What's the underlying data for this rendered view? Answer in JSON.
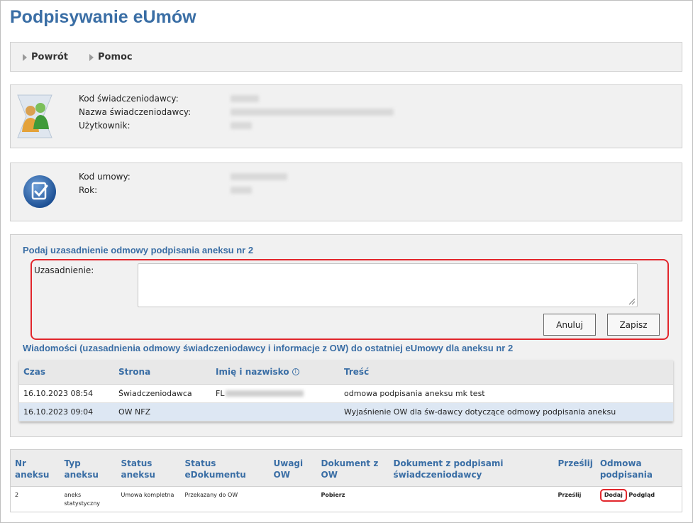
{
  "page": {
    "title": "Podpisywanie eUmów"
  },
  "nav": {
    "back_label": "Powrót",
    "help_label": "Pomoc"
  },
  "provider": {
    "code_label": "Kod świadczeniodawcy:",
    "name_label": "Nazwa świadczeniodawcy:",
    "user_label": "Użytkownik:"
  },
  "contract": {
    "code_label": "Kod umowy:",
    "year_label": "Rok:"
  },
  "reason_form": {
    "heading": "Podaj uzasadnienie odmowy podpisania aneksu nr 2",
    "field_label": "Uzasadnienie:",
    "value": "",
    "cancel_label": "Anuluj",
    "save_label": "Zapisz"
  },
  "messages": {
    "heading": "Wiadomości (uzasadnienia odmowy świadczeniodawcy i informacje z OW) do ostatniej eUmowy dla aneksu nr 2",
    "columns": {
      "time": "Czas",
      "side": "Strona",
      "name": "Imię i nazwisko",
      "content": "Treść"
    },
    "info_glyph": "i",
    "rows": [
      {
        "time": "16.10.2023 08:54",
        "side": "Świadczeniodawca",
        "name": "FL",
        "content": "odmowa podpisania aneksu mk test"
      },
      {
        "time": "16.10.2023 09:04",
        "side": "OW NFZ",
        "name": "",
        "content": "Wyjaśnienie OW dla św-dawcy dotyczące odmowy podpisania aneksu"
      }
    ]
  },
  "annex": {
    "columns": {
      "nr_line1": "Nr",
      "nr_line2": "aneksu",
      "type_line1": "Typ",
      "type_line2": "aneksu",
      "status_line1": "Status",
      "status_line2": "aneksu",
      "edoc_line1": "Status",
      "edoc_line2": "eDokumentu",
      "remarks_line1": "Uwagi",
      "remarks_line2": "OW",
      "doc_line1": "Dokument z",
      "doc_line2": "OW",
      "signed_line1": "Dokument z podpisami",
      "signed_line2": "świadczeniodawcy",
      "send": "Prześlij",
      "refusal_line1": "Odmowa",
      "refusal_line2": "podpisania"
    },
    "row": {
      "nr": "2",
      "type_line1": "aneks",
      "type_line2": "statystyczny",
      "status": "Umowa kompletna",
      "edoc_status": "Przekazany do OW",
      "remarks": "",
      "doc": "Pobierz",
      "signed_doc": "",
      "send": "Prześlij",
      "refusal_add": "Dodaj",
      "refusal_preview": "Podgląd"
    }
  },
  "colors": {
    "accent": "#3a6ea5",
    "highlight": "#e2262c",
    "panel_bg": "#f1f1f1",
    "alt_row": "#dde7f3"
  },
  "icons": {
    "back": "triangle-right-icon",
    "help": "triangle-right-icon",
    "provider": "users-icon",
    "contract": "check-document-icon",
    "info": "info-icon",
    "resize": "resize-grip-icon"
  }
}
